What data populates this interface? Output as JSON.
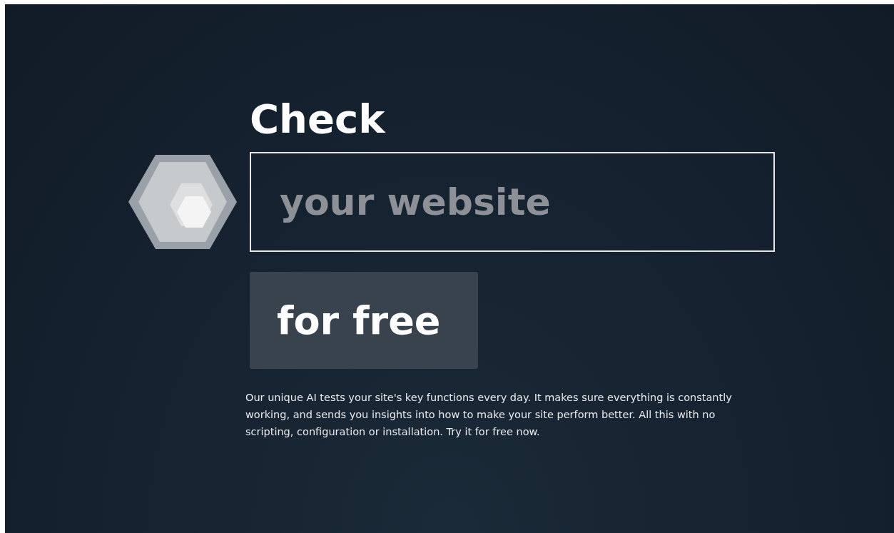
{
  "headline": "Check",
  "url_field": {
    "placeholder": "your website"
  },
  "cta_button": {
    "label": "for free"
  },
  "description": "Our unique AI tests your site's key functions every day. It makes sure everything is constantly working, and sends you insights into how to make your site perform better. All this with no scripting, configuration or installation. Try it for free now."
}
